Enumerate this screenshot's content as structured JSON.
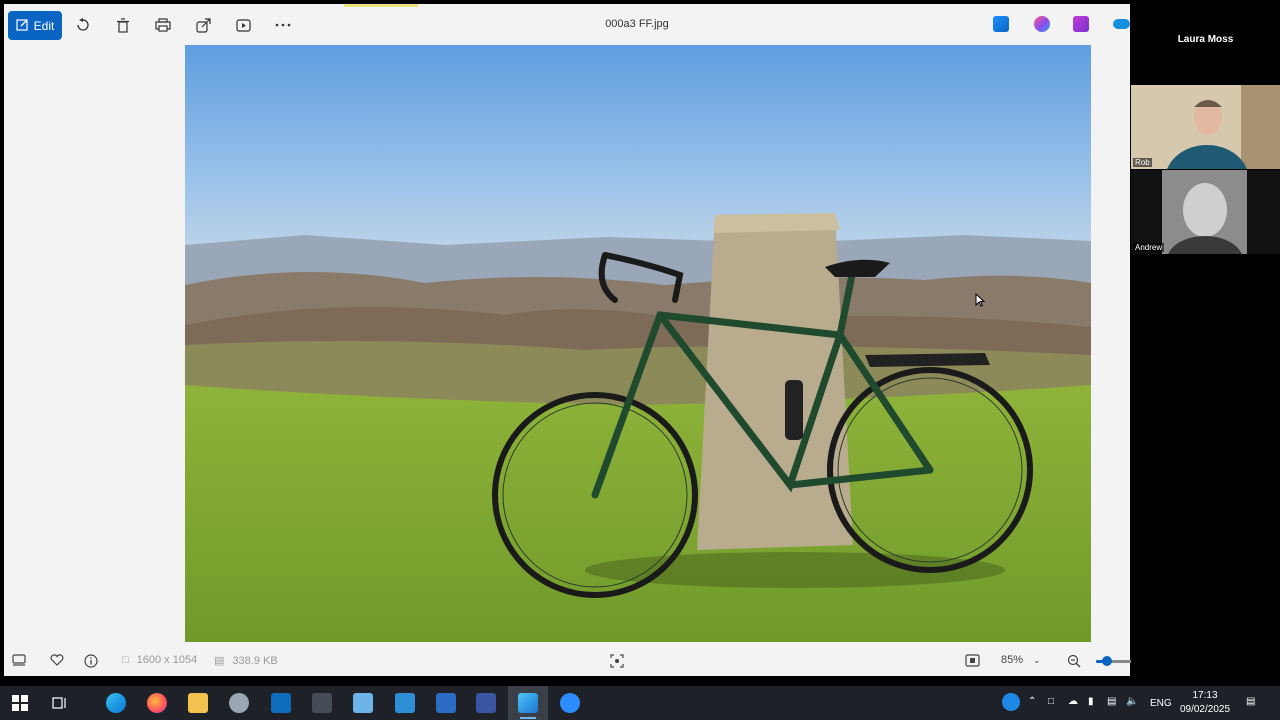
{
  "app": {
    "file_name": "000a3 FF.jpg",
    "edit_label": "Edit",
    "accent_color": "#0a64c2"
  },
  "toolbar_icons": [
    "rotate-icon",
    "delete-icon",
    "print-icon",
    "share-icon",
    "slideshow-icon",
    "more-icon"
  ],
  "right_app_icons": [
    "designer-icon",
    "copilot-icon",
    "clipchamp-icon",
    "onedrive-icon"
  ],
  "image": {
    "description_icon": "photo-bicycle-trig-point"
  },
  "bottom_bar": {
    "dimensions": "1600 x 1054",
    "file_size": "338.9 KB",
    "zoom_level": "85%",
    "zoom_fraction": 0.1
  },
  "call": {
    "speaker": "Laura Moss",
    "participants": [
      {
        "name": "Rob"
      },
      {
        "name": "Andrew"
      }
    ]
  },
  "taskbar": {
    "language": "ENG",
    "time": "17:13",
    "date": "09/02/2025",
    "apps": [
      "start-icon",
      "task-view-icon",
      "edge-icon",
      "firefox-icon",
      "file-explorer-icon",
      "app-icon",
      "outlook-icon",
      "app-icon-2",
      "app-icon-3",
      "app-icon-4",
      "word-icon",
      "visio-icon",
      "photos-icon",
      "zoom-icon"
    ]
  }
}
